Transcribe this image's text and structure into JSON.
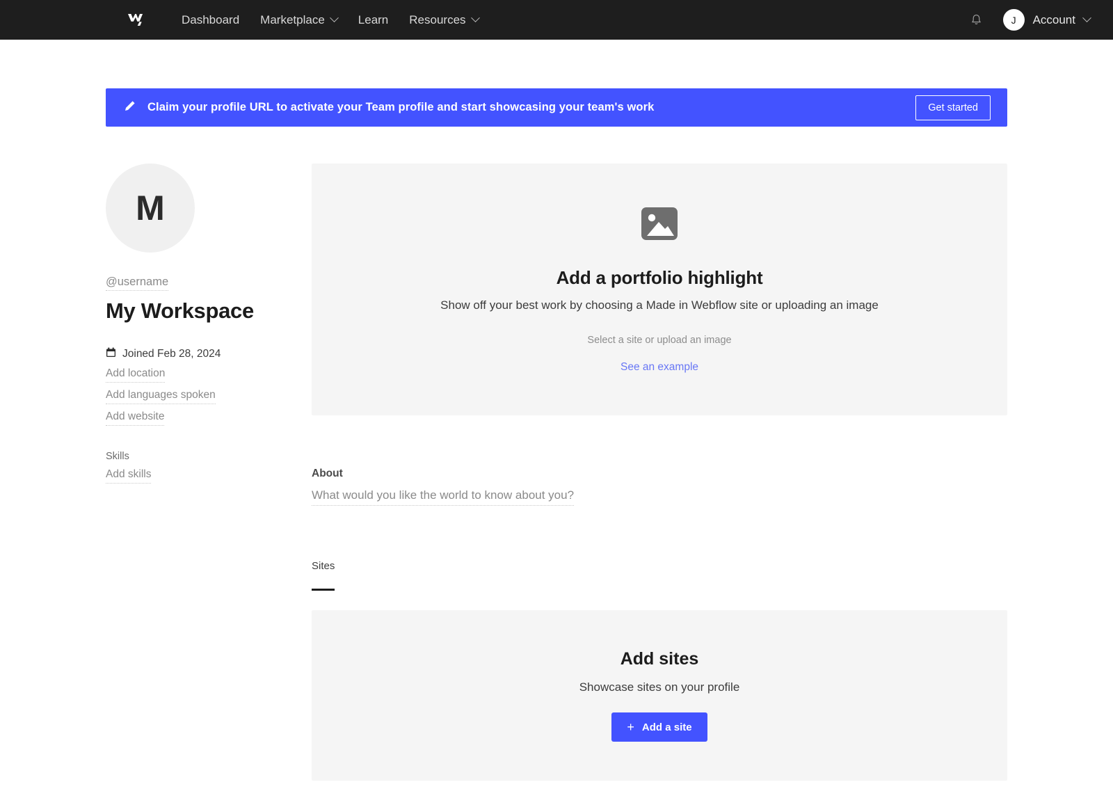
{
  "nav": {
    "logo_icon": "webflow-logo-icon",
    "links": [
      {
        "label": "Dashboard",
        "has_caret": false
      },
      {
        "label": "Marketplace",
        "has_caret": true
      },
      {
        "label": "Learn",
        "has_caret": false
      },
      {
        "label": "Resources",
        "has_caret": true
      }
    ],
    "notifications_icon": "bell-icon",
    "avatar_initial": "J",
    "account_label": "Account",
    "account_caret_icon": "chevron-down-icon",
    "bg_color": "#1e1e1e"
  },
  "banner": {
    "icon": "pencil-icon",
    "message": "Claim your profile URL to activate your Team profile and start showcasing your team's work",
    "cta_label": "Get started",
    "bg_color": "#4353ff"
  },
  "profile": {
    "avatar_initial": "M",
    "username": "@username",
    "workspace_name": "My Workspace",
    "joined_icon": "calendar-icon",
    "joined_text": "Joined Feb 28, 2024",
    "add_location": "Add location",
    "add_languages": "Add languages spoken",
    "add_website": "Add website",
    "skills_title": "Skills",
    "add_skills": "Add skills"
  },
  "portfolio": {
    "icon": "image-placeholder-icon",
    "title": "Add a portfolio highlight",
    "subtitle": "Show off your best work by choosing a Made in Webflow site or uploading an image",
    "hint": "Select a site or upload an image",
    "link_label": "See an example",
    "link_color": "#6877f5",
    "bg_color": "#f5f5f5"
  },
  "about": {
    "label": "About",
    "placeholder": "What would you like the world to know about you?"
  },
  "tabs": [
    {
      "label": "Sites",
      "active": true
    }
  ],
  "sites": {
    "title": "Add sites",
    "subtitle": "Showcase sites on your profile",
    "button_label": "Add a site",
    "button_icon": "plus-icon",
    "button_color": "#4353ff",
    "bg_color": "#f5f5f5"
  }
}
